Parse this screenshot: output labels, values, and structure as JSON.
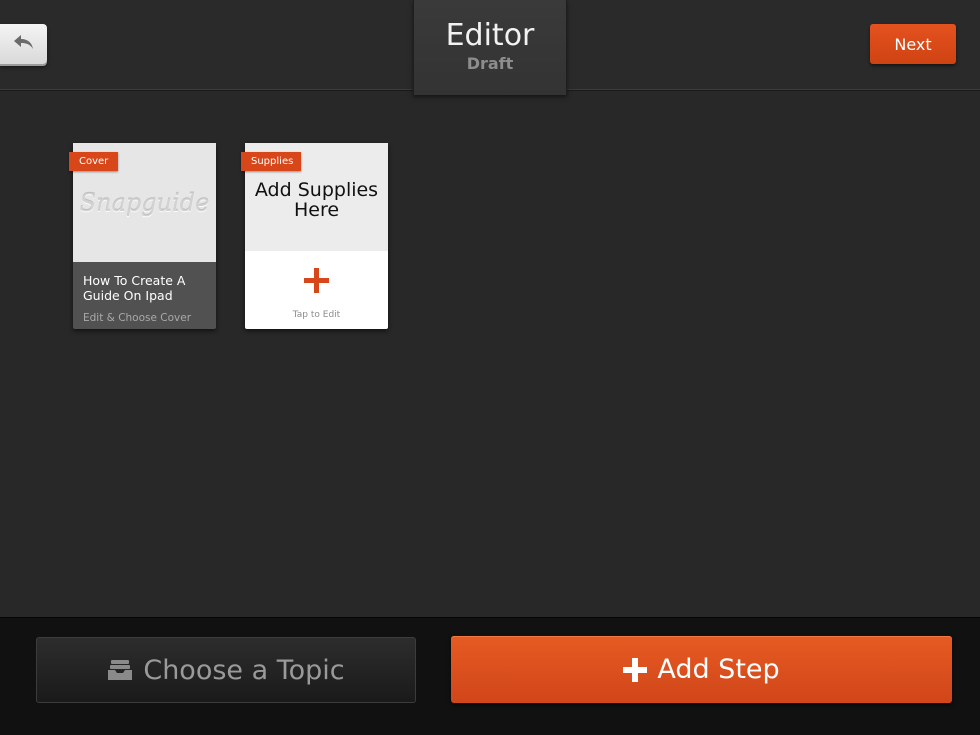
{
  "header": {
    "title": "Editor",
    "status": "Draft",
    "next_label": "Next",
    "back_icon": "undo-arrow-icon"
  },
  "cards": {
    "cover": {
      "ribbon": "Cover",
      "logo_text": "Snapguide",
      "title": "How To Create A Guide On Ipad",
      "subtitle": "Edit & Choose Cover"
    },
    "supplies": {
      "ribbon": "Supplies",
      "heading": "Add Supplies Here",
      "plus_icon": "plus-icon",
      "hint": "Tap to Edit"
    }
  },
  "footer": {
    "topic_label": "Choose a Topic",
    "topic_icon": "inbox-tray-icon",
    "add_step_label": "Add Step",
    "add_step_icon": "plus-icon"
  },
  "colors": {
    "accent": "#d8471a",
    "background": "#282828"
  }
}
